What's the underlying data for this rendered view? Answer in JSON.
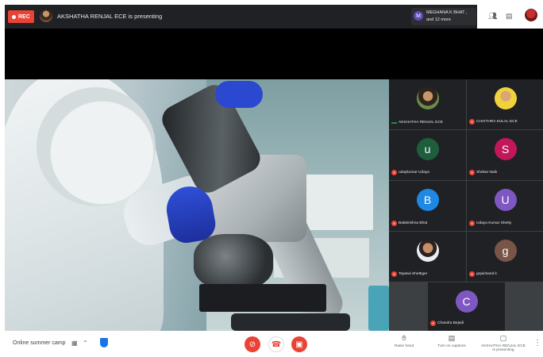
{
  "topbar": {
    "rec_label": "REC",
    "presenting_text": "AKSHATHA RENJAL ECE is presenting",
    "people_chip": {
      "initial": "M",
      "line1": "MEGHANA K BHAT ,",
      "line2": "and 12 more"
    },
    "icons": {
      "people": "people-icon",
      "chat": "chat-icon"
    }
  },
  "participants": [
    {
      "name": "AKSHATHA RENJAL ECE",
      "avatar_type": "photo",
      "muted": false
    },
    {
      "name": "CHAITHRA KULAL ECE",
      "avatar_type": "photo",
      "muted": true
    },
    {
      "name": "udaykumar Udaya",
      "initial": "u",
      "color": "#1e5e3c",
      "muted": true
    },
    {
      "name": "Shekar Naik",
      "initial": "S",
      "color": "#c2185b",
      "muted": true
    },
    {
      "name": "Balakrishna Bhat",
      "initial": "B",
      "color": "#1e88e5",
      "muted": true
    },
    {
      "name": "Udaya Kumar Shetty",
      "initial": "U",
      "color": "#7e57c2",
      "muted": true
    },
    {
      "name": "Tejaswi Shettiger",
      "avatar_type": "photo",
      "muted": true
    },
    {
      "name": "gopichand k",
      "initial": "g",
      "color": "#795548",
      "muted": true
    },
    {
      "name": "Chandra Bejadi",
      "initial": "C",
      "color": "#7e57c2",
      "muted": true
    }
  ],
  "bottombar": {
    "meeting_name": "Online summer camp",
    "raise_hand": "Raise hand",
    "captions": "Turn on captions",
    "presenting_line1": "AKSHATHA RENJAL ECE",
    "presenting_line2": "is presenting"
  },
  "colors": {
    "red": "#ea4335",
    "dark": "#202124",
    "grid_bg": "#3c4043"
  }
}
